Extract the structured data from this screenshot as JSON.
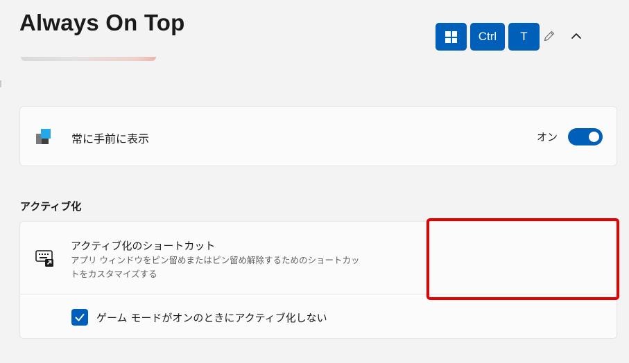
{
  "page": {
    "title": "Always On Top"
  },
  "always_on_top": {
    "label": "常に手前に表示",
    "toggle_state": "オン",
    "enabled": true
  },
  "activation": {
    "section_title": "アクティブ化",
    "shortcut": {
      "title": "アクティブ化のショートカット",
      "description": "アプリ ウィンドウをピン留めまたはピン留め解除するためのショートカットをカスタマイズする",
      "keys": [
        "Win",
        "Ctrl",
        "T"
      ],
      "key_ctrl_label": "Ctrl",
      "key_t_label": "T"
    },
    "game_mode": {
      "label": "ゲーム モードがオンのときにアクティブ化しない",
      "checked": true
    }
  },
  "colors": {
    "accent": "#005fb8",
    "highlight": "#e60000",
    "card_bg": "#fbfbfb",
    "page_bg": "#f3f3f3"
  },
  "icons": [
    "always-on-top-app-icon",
    "keyboard-shortcut-icon",
    "windows-key-icon",
    "pencil-icon",
    "chevron-up-icon",
    "checkmark-icon"
  ]
}
